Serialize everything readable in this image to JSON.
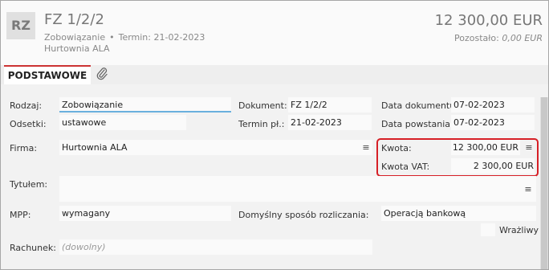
{
  "header": {
    "badge": "RZ",
    "title": "FZ 1/2/2",
    "type": "Zobowiązanie",
    "term": "Termin: 21-02-2023",
    "counterparty": "Hurtownia ALA",
    "amount": "12 300,00 EUR",
    "remaining_label": "Pozostało:",
    "remaining_value": "0,00 EUR"
  },
  "tabs": {
    "basic": "PODSTAWOWE"
  },
  "form": {
    "rodzaj": {
      "label": "Rodzaj:",
      "value": "Zobowiązanie"
    },
    "odsetki": {
      "label": "Odsetki:",
      "value": "ustawowe"
    },
    "dokument": {
      "label": "Dokument:",
      "value": "FZ 1/2/2"
    },
    "termin": {
      "label": "Termin pł.:",
      "value": "21-02-2023"
    },
    "data_dokumentu": {
      "label": "Data dokumentu:",
      "value": "07-02-2023"
    },
    "data_powstania": {
      "label": "Data powstania:",
      "value": "07-02-2023"
    },
    "firma": {
      "label": "Firma:",
      "value": "Hurtownia ALA"
    },
    "kwota": {
      "label": "Kwota:",
      "value": "12 300,00 EUR"
    },
    "kwota_vat": {
      "label": "Kwota VAT:",
      "value": "2 300,00 EUR"
    },
    "tytulem": {
      "label": "Tytułem:",
      "value": ""
    },
    "mpp": {
      "label": "MPP:",
      "value": "wymagany"
    },
    "sposob": {
      "label": "Domyślny sposób rozliczania:",
      "value": "Operacją bankową"
    },
    "wrazliwy": {
      "label": "Wrażliwy"
    },
    "rachunek": {
      "label": "Rachunek:",
      "placeholder": "(dowolny)"
    }
  },
  "colors": {
    "highlight": "#d61f26",
    "tab_accent": "#cc3333",
    "active_underline": "#6ab0de"
  },
  "icons": {
    "menu": "hamburger-icon",
    "attachment": "paperclip-icon"
  }
}
